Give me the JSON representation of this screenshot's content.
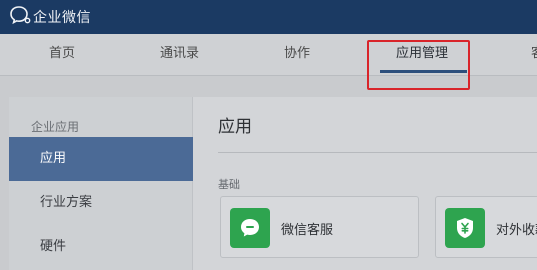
{
  "app": {
    "title": "企业微信"
  },
  "nav": {
    "items": [
      {
        "label": "首页"
      },
      {
        "label": "通讯录"
      },
      {
        "label": "协作"
      },
      {
        "label": "应用管理"
      },
      {
        "label": "客"
      }
    ],
    "active": "应用管理"
  },
  "sidebar": {
    "group_label": "企业应用",
    "items": [
      {
        "label": "应用"
      },
      {
        "label": "行业方案"
      },
      {
        "label": "硬件"
      }
    ],
    "active": "应用"
  },
  "main": {
    "title": "应用",
    "section_label": "基础",
    "cards": [
      {
        "label": "微信客服",
        "icon": "chat-bubble-icon"
      },
      {
        "label": "对外收款",
        "icon": "yuan-shield-icon"
      }
    ]
  },
  "colors": {
    "topbar": "#1b3a63",
    "active_sidebar": "#4b6a96",
    "nav_underline": "#2d4f7c",
    "highlight_box": "#d9242a",
    "app_icon_green": "#2ea44f"
  }
}
